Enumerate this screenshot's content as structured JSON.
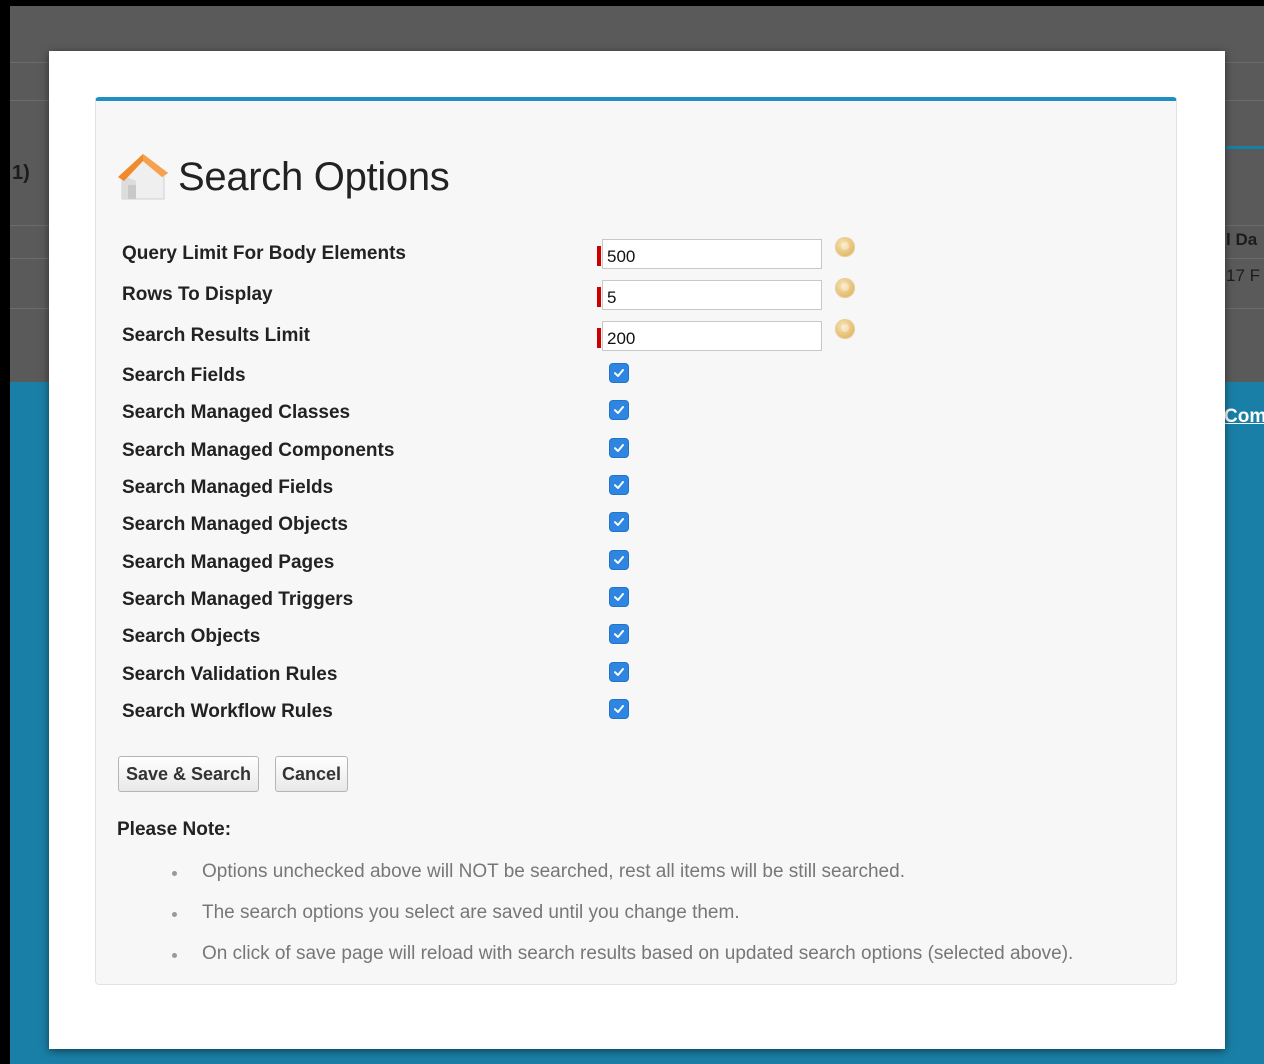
{
  "backdrop": {
    "left_fragment": "1)",
    "right_header_fragment": "l Da",
    "right_cell_fragment": "17 F",
    "right_link_fragment": "Com"
  },
  "modal": {
    "title": "Search Options",
    "icon": "home-icon",
    "text_fields": [
      {
        "label": "Query Limit For Body Elements",
        "value": "500",
        "required": true,
        "help_icon": "help-icon"
      },
      {
        "label": "Rows To Display",
        "value": "5",
        "required": true,
        "help_icon": "help-icon"
      },
      {
        "label": "Search Results Limit",
        "value": "200",
        "required": true,
        "help_icon": "help-icon"
      }
    ],
    "checkboxes": [
      {
        "label": "Search Fields",
        "checked": true
      },
      {
        "label": "Search Managed Classes",
        "checked": true
      },
      {
        "label": "Search Managed Components",
        "checked": true
      },
      {
        "label": "Search Managed Fields",
        "checked": true
      },
      {
        "label": "Search Managed Objects",
        "checked": true
      },
      {
        "label": "Search Managed Pages",
        "checked": true
      },
      {
        "label": "Search Managed Triggers",
        "checked": true
      },
      {
        "label": "Search Objects",
        "checked": true
      },
      {
        "label": "Search Validation Rules",
        "checked": true
      },
      {
        "label": "Search Workflow Rules",
        "checked": true
      }
    ],
    "buttons": {
      "save": "Save & Search",
      "cancel": "Cancel"
    },
    "note_title": "Please Note:",
    "notes": [
      "Options unchecked above will NOT be searched, rest all items will be still searched.",
      "The search options you select are saved until you change them.",
      "On click of save page will reload with search results based on updated search options (selected above)."
    ]
  },
  "colors": {
    "accent": "#1f8fc4",
    "required": "#cc0000",
    "checkbox": "#2f86e0",
    "backdrop_blue": "#1a7fa6"
  }
}
